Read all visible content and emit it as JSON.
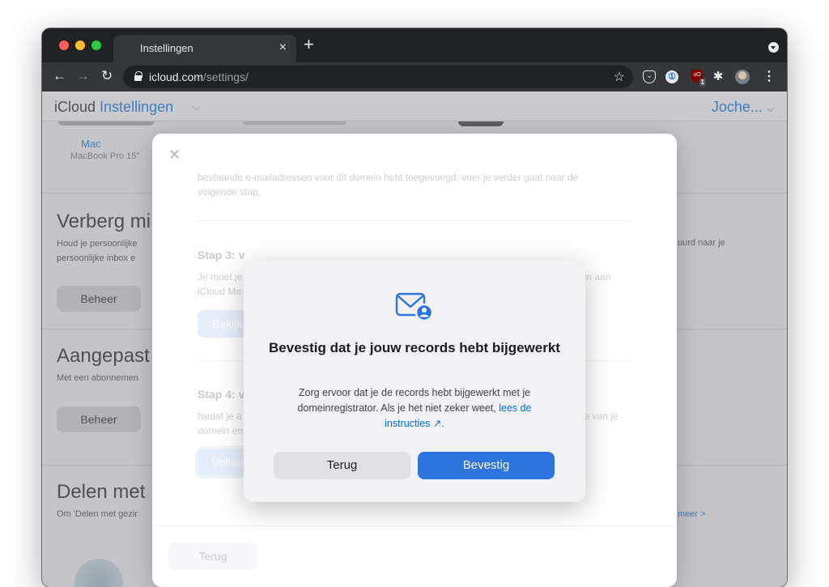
{
  "browser": {
    "tab_title": "Instellingen",
    "url_host": "icloud.com",
    "url_path": "/settings/",
    "ublock_badge": "1",
    "ublock_icon_text": "uO"
  },
  "app": {
    "brand": "iCloud",
    "section": "Instellingen",
    "user": "Joche..."
  },
  "background": {
    "device_name": "Mac",
    "device_model": "MacBook Pro 15\"",
    "sections": [
      {
        "title": "Verberg mi",
        "desc1": "Houd je persoonlijke",
        "desc2": "persoonlijke inbox e",
        "right": "uurd naar je",
        "button": "Beheer"
      },
      {
        "title": "Aangepast",
        "desc1": "Met een abonnemen",
        "button": "Beheer"
      },
      {
        "title": "Delen met",
        "desc1": "Om 'Delen met gezir",
        "right_link": "meer >"
      }
    ]
  },
  "sheet": {
    "faded_line1": "bestaande e-mailadressen voor dit domein hebt toegevoegd, voer je verder gaat naar de",
    "faded_line2": "volgende stap.",
    "step3_title": "Stap 3: v",
    "step3_desc1": "Je moet je",
    "step3_desc2": "iCloud Ma",
    "step3_desc_right": "ein aan",
    "step3_button": "Bekijk",
    "step4_title": "Stap 4: v",
    "step4_desc1": "Nadat je a",
    "step4_desc2": "domein en",
    "step4_desc_right": "de van je",
    "step4_button": "Voltoo",
    "back": "Terug"
  },
  "dialog": {
    "title": "Bevestig dat je jouw records hebt bijgewerkt",
    "body_text": "Zorg ervoor dat je de records hebt bijgewerkt met je domeinregistrator. Als je het niet zeker weet,",
    "body_link": "lees de instructies ↗.",
    "back_label": "Terug",
    "confirm_label": "Bevestig",
    "accent": "#2f74de"
  }
}
